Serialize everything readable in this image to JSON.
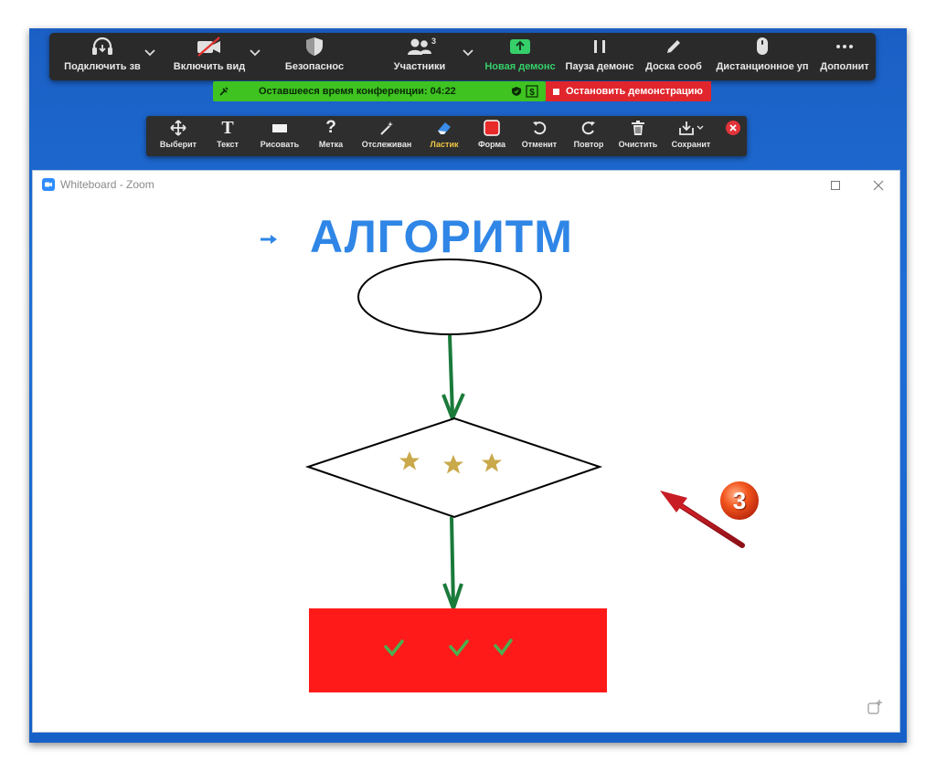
{
  "toolbar": {
    "audio_label": "Подключить зв",
    "video_label": "Включить вид",
    "security_label": "Безопаснос",
    "participants_label": "Участники",
    "participants_count": "3",
    "new_share_label": "Новая демонс",
    "pause_share_label": "Пауза демонс",
    "annotate_label": "Доска сооб",
    "remote_control_label": "Дистанционное уп",
    "more_label": "Дополнит"
  },
  "status": {
    "time_text": "Оставшееся время конференции: 04:22",
    "stop_share_label": "Остановить демонстрацию"
  },
  "annotation": {
    "select": "Выберит",
    "text": "Текст",
    "draw": "Рисовать",
    "stamp": "Метка",
    "spotlight": "Отслеживан",
    "eraser": "Ластик",
    "format": "Форма",
    "undo": "Отменит",
    "redo": "Повтор",
    "clear": "Очистить",
    "save": "Сохранит"
  },
  "whiteboard": {
    "window_title": "Whiteboard - Zoom",
    "heading": "АЛГОРИТМ",
    "callout_number": "3"
  },
  "colors": {
    "accent_blue": "#2f86e6",
    "arrow_green": "#1a7a3a",
    "rect_red": "#ff1a1a",
    "star_gold": "#c9a94a",
    "check_green": "#4caf50",
    "status_green": "#3ec321",
    "stop_red": "#e0262c"
  }
}
